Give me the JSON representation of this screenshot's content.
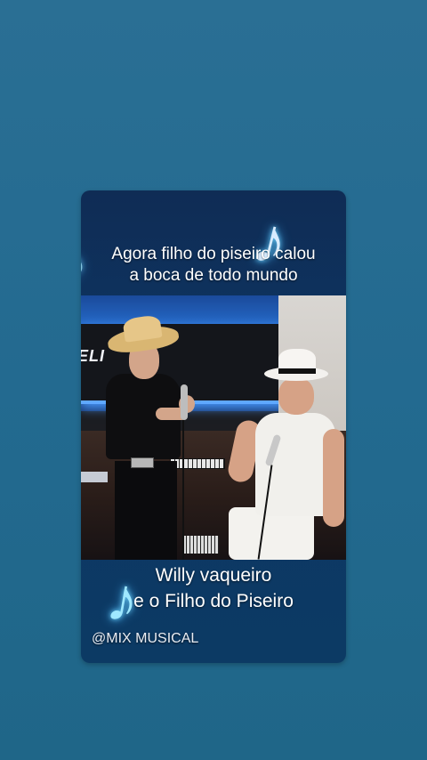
{
  "caption_top": {
    "line1": "Agora filho do piseiro calou",
    "line2": "a boca de todo mundo"
  },
  "scene": {
    "studio_sign": "ELI      IC",
    "description_icons": [
      "music-note-icon"
    ]
  },
  "caption_bottom": {
    "line1": "Willy vaqueiro",
    "line2": "e o Filho do Piseiro"
  },
  "watermark": "@MIX MUSICAL",
  "icons": {
    "top_note": "♪",
    "left_note": "♪",
    "bottom_note": "♪"
  },
  "colors": {
    "background": "#236a90",
    "card": "#0e3663",
    "note_glow": "#6fd6ff"
  }
}
